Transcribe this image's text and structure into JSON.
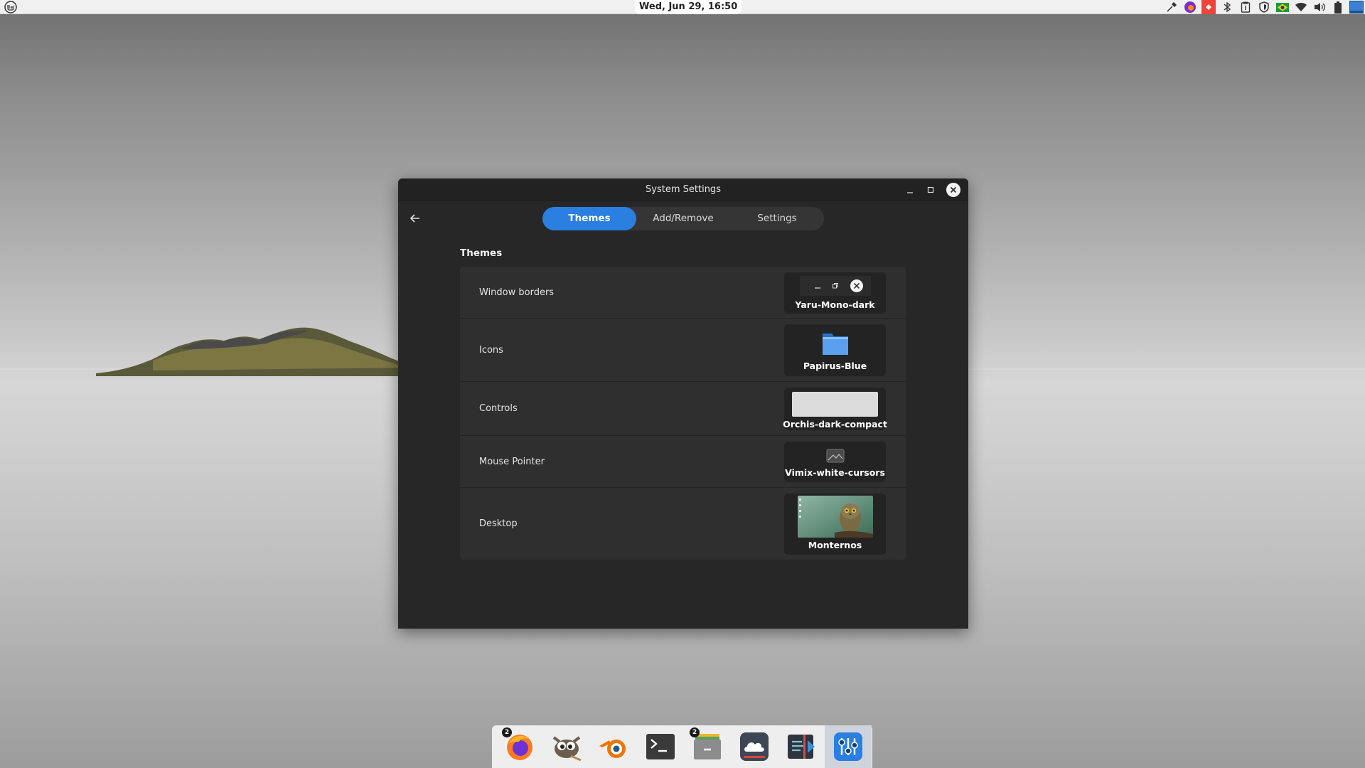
{
  "panel": {
    "clock": "Wed, Jun 29, 16:50",
    "menu_icon": "linux-mint-icon",
    "tray_icons": [
      "color-picker-icon",
      "firefox-tray-icon",
      "anydesk-icon",
      "bluetooth-icon",
      "clipboard-icon",
      "shield-icon",
      "brazil-flag-icon",
      "wifi-icon",
      "volume-icon",
      "battery-icon",
      "workspace-icon"
    ]
  },
  "window": {
    "title": "System Settings",
    "tabs": [
      {
        "label": "Themes",
        "active": true
      },
      {
        "label": "Add/Remove",
        "active": false
      },
      {
        "label": "Settings",
        "active": false
      }
    ],
    "section_title": "Themes",
    "rows": [
      {
        "label": "Window borders",
        "value": "Yaru-Mono-dark"
      },
      {
        "label": "Icons",
        "value": "Papirus-Blue"
      },
      {
        "label": "Controls",
        "value": "Orchis-dark-compact"
      },
      {
        "label": "Mouse Pointer",
        "value": "Vimix-white-cursors"
      },
      {
        "label": "Desktop",
        "value": "Monternos"
      }
    ]
  },
  "dock": {
    "items": [
      {
        "name": "firefox",
        "badge": "2"
      },
      {
        "name": "gimp",
        "badge": ""
      },
      {
        "name": "blender",
        "badge": ""
      },
      {
        "name": "terminal",
        "badge": ""
      },
      {
        "name": "file-manager",
        "badge": "2"
      },
      {
        "name": "cloud-app",
        "badge": ""
      },
      {
        "name": "code-editor",
        "badge": ""
      },
      {
        "name": "system-settings",
        "badge": ""
      }
    ]
  },
  "colors": {
    "accent": "#2a7fe0",
    "window_bg": "#272727",
    "list_bg": "#2f2f2f"
  }
}
